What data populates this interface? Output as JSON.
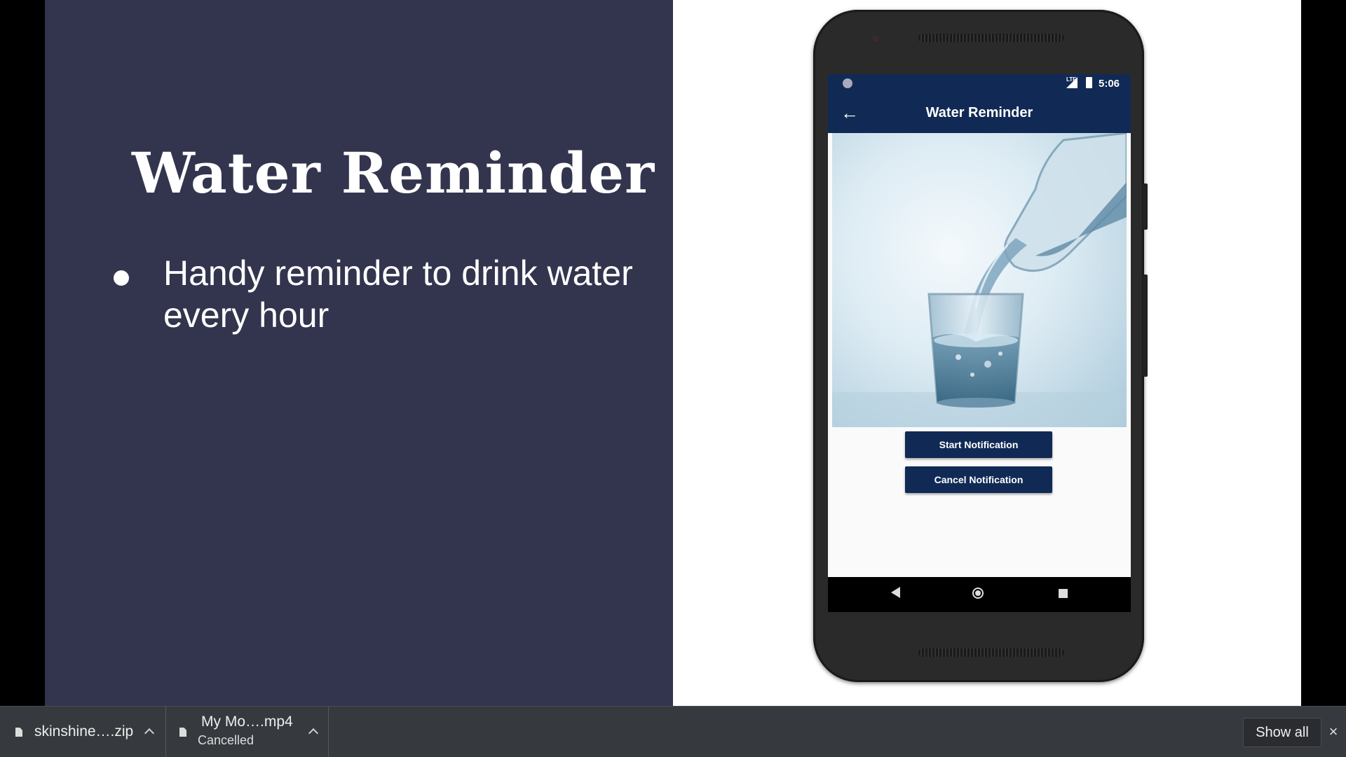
{
  "slide": {
    "title": "Water Reminder",
    "bullets": [
      "Handy reminder to drink water every hour"
    ]
  },
  "phone": {
    "status_time": "5:06",
    "status_network": "LTE",
    "app_title": "Water Reminder",
    "hero_image": "water-pouring-into-glass",
    "buttons": {
      "start": "Start Notification",
      "cancel": "Cancel Notification"
    },
    "colors": {
      "app_primary": "#102a55"
    }
  },
  "downloads": {
    "items": [
      {
        "name": "skinshine….zip",
        "status": ""
      },
      {
        "name": "My Mo….mp4",
        "status": "Cancelled"
      }
    ],
    "show_all": "Show all",
    "close": "×"
  },
  "colors": {
    "slide_left_bg": "#33344e",
    "slide_right_bg": "#ffffff",
    "download_bar_bg": "#36393e"
  }
}
